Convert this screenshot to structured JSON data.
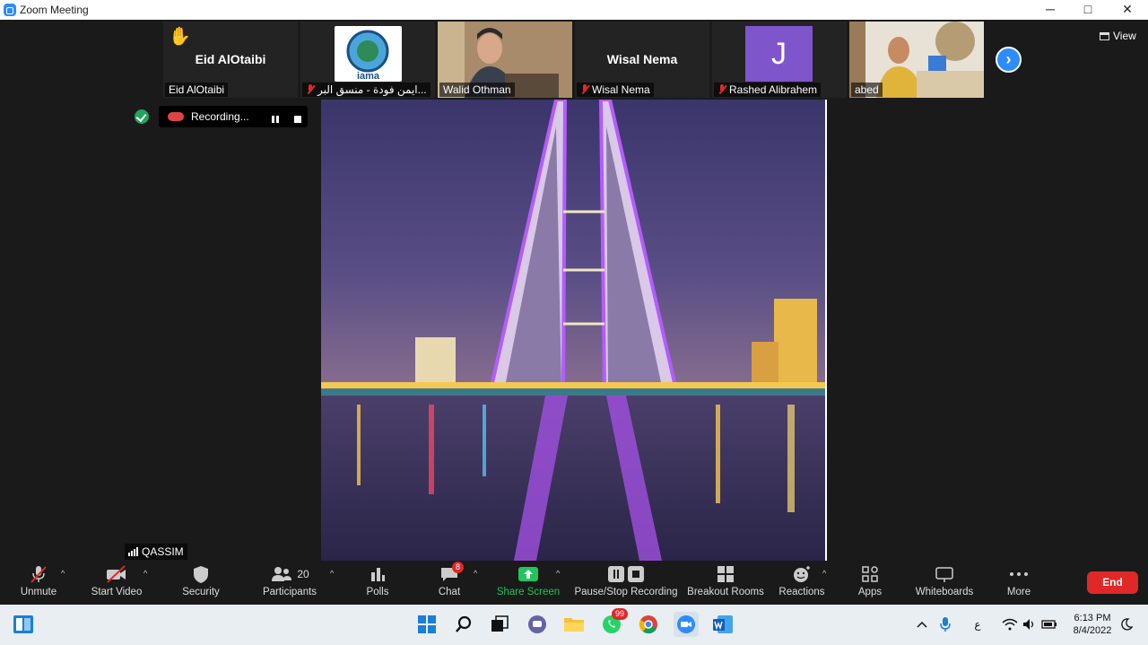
{
  "window": {
    "title": "Zoom Meeting",
    "minimize": "─",
    "maximize": "□",
    "close": "✕"
  },
  "participants": [
    {
      "tile_name": "Eid AlOtaibi",
      "label": "Eid AlOtaibi",
      "muted": false,
      "hand_raised": true
    },
    {
      "label": "ايمن فودة - منسق البر...",
      "muted": true,
      "logo_text": "iama"
    },
    {
      "label": "Walid Othman",
      "muted": false
    },
    {
      "tile_name": "Wisal Nema",
      "label": "Wisal Nema",
      "muted": true
    },
    {
      "avatar_letter": "J",
      "label": "Rashed Alibrahem",
      "muted": true
    },
    {
      "label": "abed",
      "muted": false
    }
  ],
  "view_button": "View",
  "recording": {
    "label": "Recording..."
  },
  "network_label": "QASSIM",
  "toolbar": {
    "unmute": "Unmute",
    "start_video": "Start Video",
    "security": "Security",
    "participants": "Participants",
    "participants_count": "20",
    "polls": "Polls",
    "chat": "Chat",
    "chat_badge": "8",
    "share_screen": "Share Screen",
    "pause_stop_recording": "Pause/Stop Recording",
    "breakout_rooms": "Breakout Rooms",
    "reactions": "Reactions",
    "apps": "Apps",
    "whiteboards": "Whiteboards",
    "more": "More",
    "end": "End"
  },
  "taskbar": {
    "whatsapp_badge": "99",
    "lang": "ع",
    "time": "6:13 PM",
    "date": "8/4/2022"
  },
  "colors": {
    "accent": "#2d8cff",
    "end": "#e02828",
    "share": "#21c55d"
  }
}
